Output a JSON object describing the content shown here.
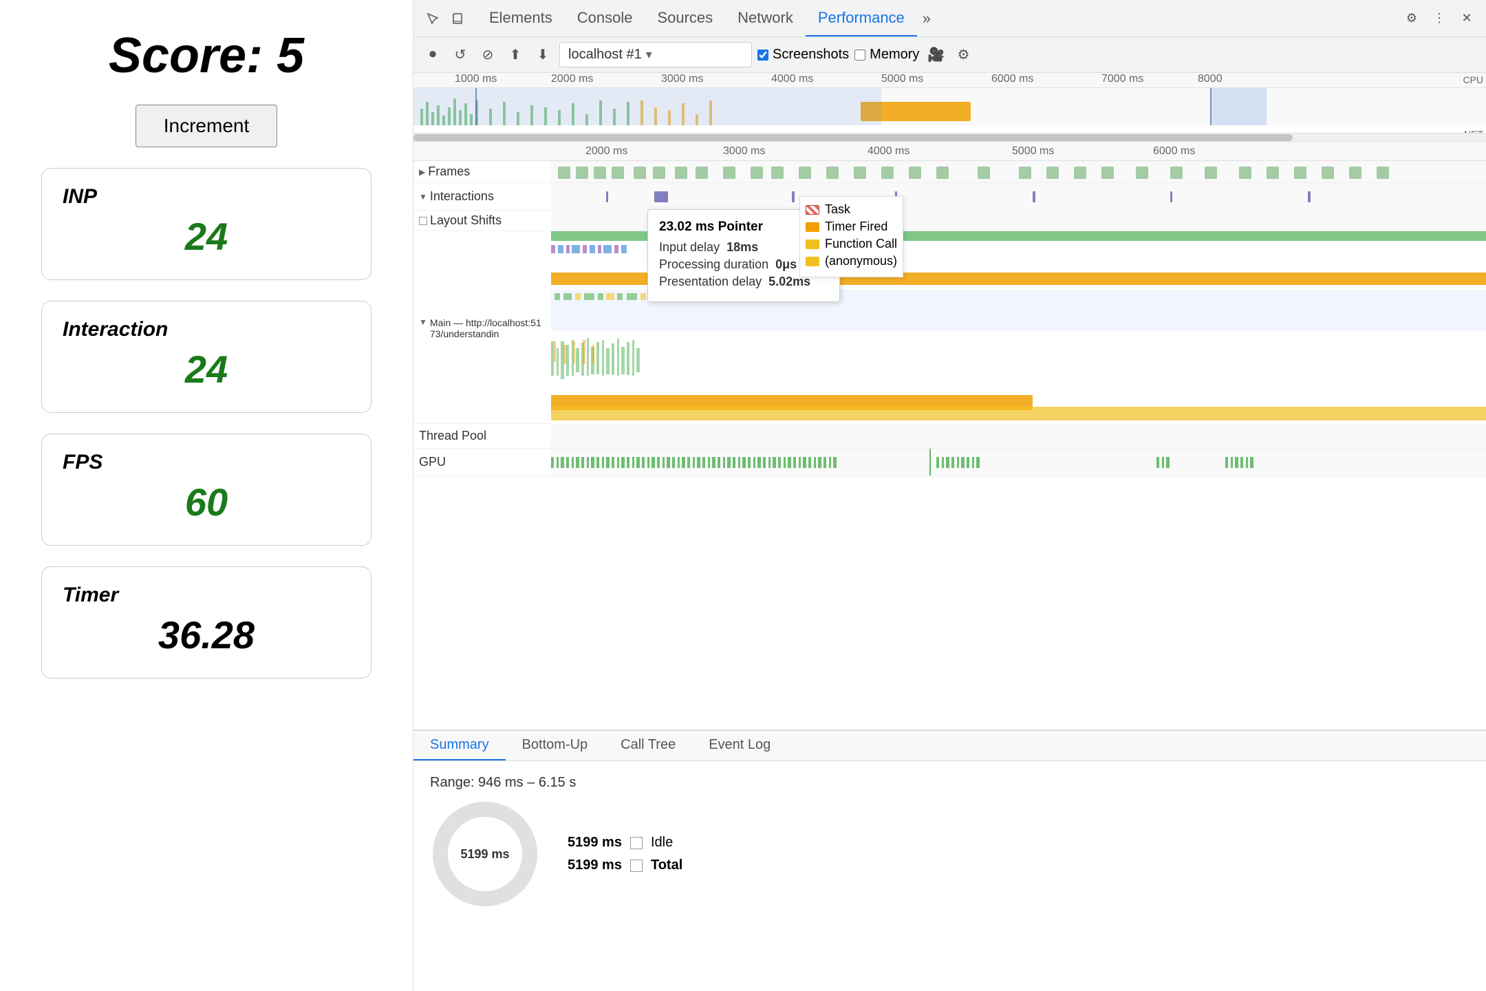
{
  "left": {
    "score_label": "Score:  5",
    "increment_btn": "Increment",
    "metrics": [
      {
        "label": "INP",
        "value": "24",
        "is_timer": false
      },
      {
        "label": "Interaction",
        "value": "24",
        "is_timer": false
      },
      {
        "label": "FPS",
        "value": "60",
        "is_timer": false
      },
      {
        "label": "Timer",
        "value": "36.28",
        "is_timer": true
      }
    ]
  },
  "devtools": {
    "tabs": [
      "Elements",
      "Console",
      "Sources",
      "Network",
      "Performance",
      "»"
    ],
    "active_tab": "Performance",
    "url": "localhost #1",
    "screenshots_label": "Screenshots",
    "memory_label": "Memory",
    "toolbar_icons": [
      "record",
      "reload",
      "clear",
      "upload",
      "download"
    ],
    "timeline": {
      "ruler_labels": [
        "1000 ms",
        "2000 ms",
        "3000 ms",
        "4000 ms",
        "5000 ms",
        "6000 ms",
        "7000 ms",
        "8000"
      ],
      "cpu_label": "CPU",
      "net_label": "NET",
      "ruler2_labels": [
        "2000 ms",
        "3000 ms",
        "4000 ms",
        "5000 ms",
        "6000 ms"
      ],
      "tracks": [
        {
          "label": "▶ Frames",
          "has_arrow": true,
          "arrow_dir": "right"
        },
        {
          "label": "▼ Interactions",
          "has_arrow": true,
          "arrow_dir": "down"
        },
        {
          "label": "□ Layout Shifts",
          "has_arrow": false
        },
        {
          "label": "▼ Main — http://localhost:5173/understandin",
          "has_arrow": true,
          "arrow_dir": "down"
        },
        {
          "label": "Thread Pool",
          "has_arrow": false
        },
        {
          "label": "GPU",
          "has_arrow": false
        }
      ]
    },
    "tooltip": {
      "title": "23.02 ms  Pointer",
      "input_delay_label": "Input delay",
      "input_delay_value": "18ms",
      "processing_label": "Processing duration",
      "processing_value": "0μs",
      "presentation_label": "Presentation delay",
      "presentation_value": "5.02ms"
    },
    "legend": {
      "items": [
        {
          "label": "Task",
          "color": "#e8685a"
        },
        {
          "label": "Timer Fired",
          "color": "#f0a000"
        },
        {
          "label": "Function Call",
          "color": "#f0c020"
        },
        {
          "label": "(anonymous)",
          "color": "#f0c020"
        }
      ]
    },
    "bottom": {
      "tabs": [
        "Summary",
        "Bottom-Up",
        "Call Tree",
        "Event Log"
      ],
      "active_tab": "Summary",
      "range_text": "Range: 946 ms – 6.15 s",
      "idle_ms": "5199 ms",
      "idle_label": "Idle",
      "total_ms": "5199 ms",
      "total_label": "Total",
      "donut_label": "5199 ms"
    }
  }
}
